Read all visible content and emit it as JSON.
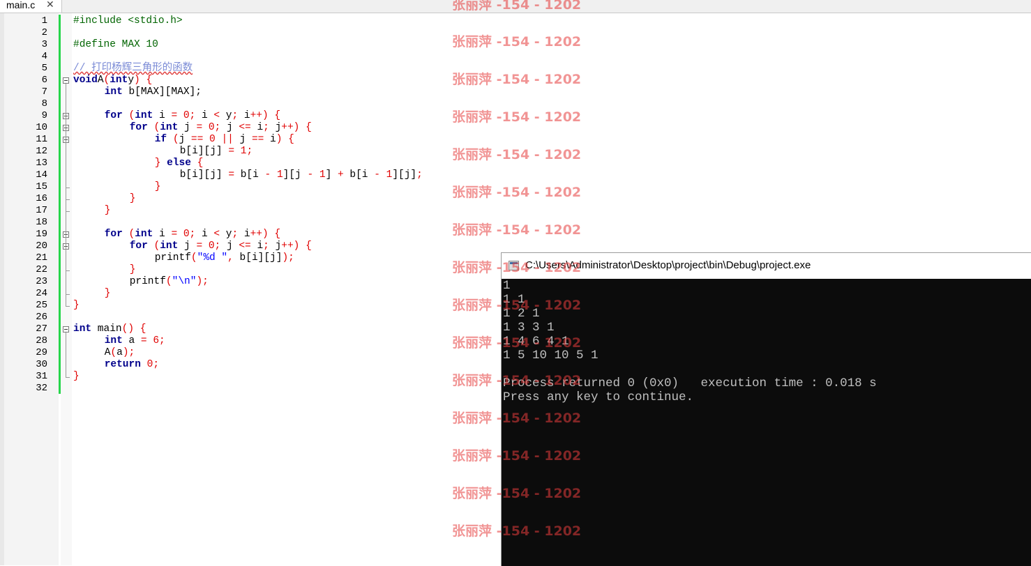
{
  "tab": {
    "label": "main.c",
    "close": "✕"
  },
  "line_numbers": [
    "1",
    "2",
    "3",
    "4",
    "5",
    "6",
    "7",
    "8",
    "9",
    "10",
    "11",
    "12",
    "13",
    "14",
    "15",
    "16",
    "17",
    "18",
    "19",
    "20",
    "21",
    "22",
    "23",
    "24",
    "25",
    "26",
    "27",
    "28",
    "29",
    "30",
    "31",
    "32"
  ],
  "code_lines": [
    [
      [
        "pp",
        "#include <stdio.h>"
      ]
    ],
    [],
    [
      [
        "pp",
        "#define MAX 10"
      ]
    ],
    [],
    [
      [
        "cm",
        "// 打印杨辉三角形的函数"
      ]
    ],
    [
      [
        "kw",
        "void"
      ],
      [
        "",
        "A"
      ],
      [
        "op",
        "("
      ],
      [
        "kw",
        "int"
      ],
      [
        "",
        "y"
      ],
      [
        "op",
        ")"
      ],
      [
        "",
        " "
      ],
      [
        "op",
        "{"
      ]
    ],
    [
      [
        "",
        " "
      ],
      [
        "kw",
        "int"
      ],
      [
        "",
        " b[MAX][MAX];"
      ]
    ],
    [],
    [
      [
        "",
        " "
      ],
      [
        "kw",
        "for"
      ],
      [
        "",
        " "
      ],
      [
        "op",
        "("
      ],
      [
        "kw",
        "int"
      ],
      [
        "",
        " i "
      ],
      [
        "op",
        "="
      ],
      [
        "",
        " "
      ],
      [
        "num",
        "0"
      ],
      [
        "op",
        ";"
      ],
      [
        "",
        " i "
      ],
      [
        "op",
        "<"
      ],
      [
        "",
        " y"
      ],
      [
        "op",
        ";"
      ],
      [
        "",
        " i"
      ],
      [
        "op",
        "++)"
      ],
      [
        "",
        " "
      ],
      [
        "op",
        "{"
      ]
    ],
    [
      [
        "",
        " "
      ],
      [
        "kw",
        "for"
      ],
      [
        "",
        " "
      ],
      [
        "op",
        "("
      ],
      [
        "kw",
        "int"
      ],
      [
        "",
        " j "
      ],
      [
        "op",
        "="
      ],
      [
        "",
        " "
      ],
      [
        "num",
        "0"
      ],
      [
        "op",
        ";"
      ],
      [
        "",
        " j "
      ],
      [
        "op",
        "<="
      ],
      [
        "",
        " i"
      ],
      [
        "op",
        ";"
      ],
      [
        "",
        " j"
      ],
      [
        "op",
        "++)"
      ],
      [
        "",
        " "
      ],
      [
        "op",
        "{"
      ]
    ],
    [
      [
        "",
        " "
      ],
      [
        "kw",
        "if"
      ],
      [
        "",
        " "
      ],
      [
        "op",
        "("
      ],
      [
        "",
        "j "
      ],
      [
        "op",
        "=="
      ],
      [
        "",
        " "
      ],
      [
        "num",
        "0"
      ],
      [
        "",
        " "
      ],
      [
        "op",
        "||"
      ],
      [
        "",
        " j "
      ],
      [
        "op",
        "=="
      ],
      [
        "",
        " i"
      ],
      [
        "op",
        ")"
      ],
      [
        "",
        " "
      ],
      [
        "op",
        "{"
      ]
    ],
    [
      [
        "",
        " b[i][j] "
      ],
      [
        "op",
        "="
      ],
      [
        "",
        " "
      ],
      [
        "num",
        "1"
      ],
      [
        "op",
        ";"
      ]
    ],
    [
      [
        "",
        " "
      ],
      [
        "op",
        "}"
      ],
      [
        "",
        " "
      ],
      [
        "kw",
        "else"
      ],
      [
        "",
        " "
      ],
      [
        "op",
        "{"
      ]
    ],
    [
      [
        "",
        " b[i][j] "
      ],
      [
        "op",
        "="
      ],
      [
        "",
        " b[i "
      ],
      [
        "op",
        "-"
      ],
      [
        "",
        " "
      ],
      [
        "num",
        "1"
      ],
      [
        "",
        "][j "
      ],
      [
        "op",
        "-"
      ],
      [
        "",
        " "
      ],
      [
        "num",
        "1"
      ],
      [
        "",
        "] "
      ],
      [
        "op",
        "+"
      ],
      [
        "",
        " b[i "
      ],
      [
        "op",
        "-"
      ],
      [
        "",
        " "
      ],
      [
        "num",
        "1"
      ],
      [
        "",
        "][j]"
      ],
      [
        "op",
        ";"
      ]
    ],
    [
      [
        "",
        " "
      ],
      [
        "op",
        "}"
      ]
    ],
    [
      [
        "",
        " "
      ],
      [
        "op",
        "}"
      ]
    ],
    [
      [
        "",
        " "
      ],
      [
        "op",
        "}"
      ]
    ],
    [],
    [
      [
        "",
        " "
      ],
      [
        "kw",
        "for"
      ],
      [
        "",
        " "
      ],
      [
        "op",
        "("
      ],
      [
        "kw",
        "int"
      ],
      [
        "",
        " i "
      ],
      [
        "op",
        "="
      ],
      [
        "",
        " "
      ],
      [
        "num",
        "0"
      ],
      [
        "op",
        ";"
      ],
      [
        "",
        " i "
      ],
      [
        "op",
        "<"
      ],
      [
        "",
        " y"
      ],
      [
        "op",
        ";"
      ],
      [
        "",
        " i"
      ],
      [
        "op",
        "++)"
      ],
      [
        "",
        " "
      ],
      [
        "op",
        "{"
      ]
    ],
    [
      [
        "",
        " "
      ],
      [
        "kw",
        "for"
      ],
      [
        "",
        " "
      ],
      [
        "op",
        "("
      ],
      [
        "kw",
        "int"
      ],
      [
        "",
        " j "
      ],
      [
        "op",
        "="
      ],
      [
        "",
        " "
      ],
      [
        "num",
        "0"
      ],
      [
        "op",
        ";"
      ],
      [
        "",
        " j "
      ],
      [
        "op",
        "<="
      ],
      [
        "",
        " i"
      ],
      [
        "op",
        ";"
      ],
      [
        "",
        " j"
      ],
      [
        "op",
        "++)"
      ],
      [
        "",
        " "
      ],
      [
        "op",
        "{"
      ]
    ],
    [
      [
        "",
        " printf"
      ],
      [
        "op",
        "("
      ],
      [
        "str",
        "\"%d \""
      ],
      [
        "op",
        ","
      ],
      [
        "",
        " b[i][j]"
      ],
      [
        "op",
        ");"
      ]
    ],
    [
      [
        "",
        " "
      ],
      [
        "op",
        "}"
      ]
    ],
    [
      [
        "",
        " printf"
      ],
      [
        "op",
        "("
      ],
      [
        "str",
        "\"\\n\""
      ],
      [
        "op",
        ");"
      ]
    ],
    [
      [
        "",
        " "
      ],
      [
        "op",
        "}"
      ]
    ],
    [
      [
        "op",
        "}"
      ]
    ],
    [],
    [
      [
        "kw",
        "int"
      ],
      [
        "",
        " main"
      ],
      [
        "op",
        "()"
      ],
      [
        "",
        " "
      ],
      [
        "op",
        "{"
      ]
    ],
    [
      [
        "",
        " "
      ],
      [
        "kw",
        "int"
      ],
      [
        "",
        " a "
      ],
      [
        "op",
        "="
      ],
      [
        "",
        " "
      ],
      [
        "num",
        "6"
      ],
      [
        "op",
        ";"
      ]
    ],
    [
      [
        "",
        " A"
      ],
      [
        "op",
        "("
      ],
      [
        "",
        "a"
      ],
      [
        "op",
        ");"
      ]
    ],
    [
      [
        "",
        " "
      ],
      [
        "kw",
        "return"
      ],
      [
        "",
        " "
      ],
      [
        "num",
        "0"
      ],
      [
        "op",
        ";"
      ]
    ],
    [
      [
        "op",
        "}"
      ]
    ],
    []
  ],
  "watermark": "张丽萍 -154 - 1202",
  "console": {
    "title": "C:\\Users\\Administrator\\Desktop\\project\\bin\\Debug\\project.exe",
    "lines": [
      "1",
      "1 1",
      "1 2 1",
      "1 3 3 1",
      "1 4 6 4 1",
      "1 5 10 10 5 1",
      "",
      "Process returned 0 (0x0)   execution time : 0.018 s",
      "Press any key to continue."
    ]
  }
}
